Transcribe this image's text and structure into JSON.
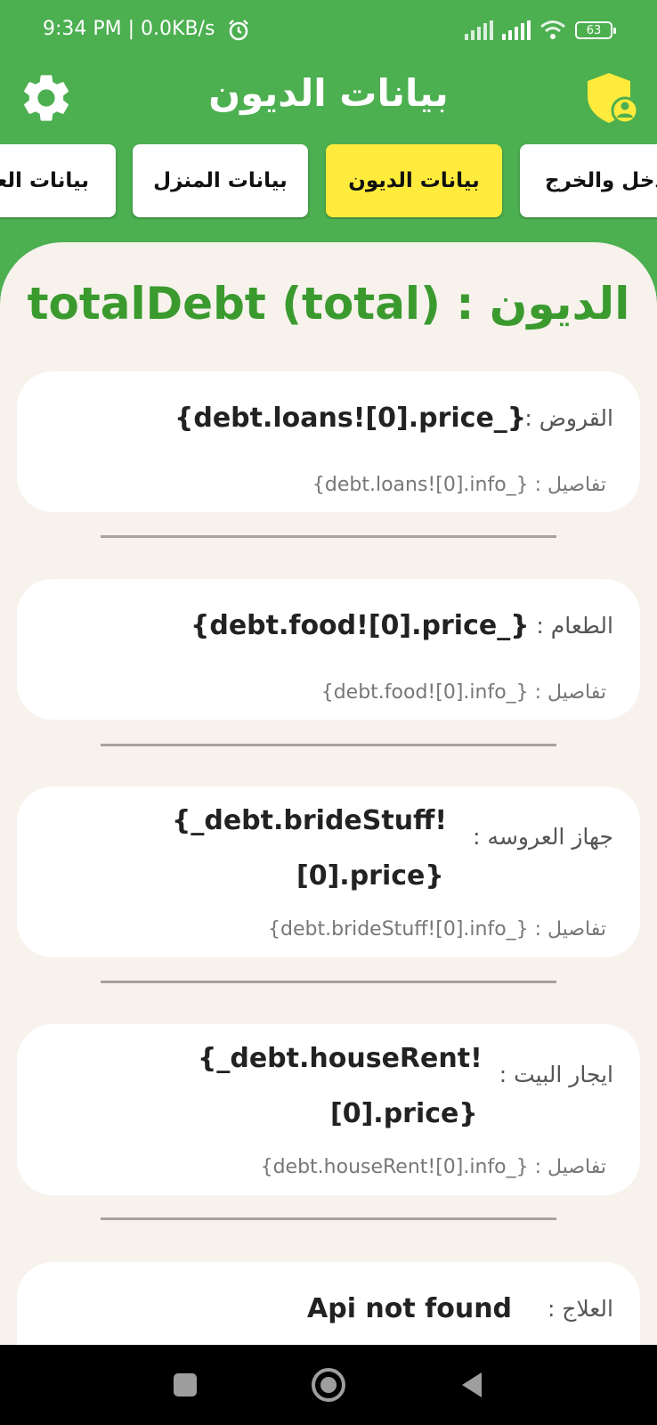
{
  "status_bar": {
    "time_speed": "9:34 PM | 0.0KB/s",
    "battery": "63"
  },
  "app_bar": {
    "title": "بيانات الديون"
  },
  "tabs": [
    {
      "label": "الدخل والخرج",
      "active": false
    },
    {
      "label": "بيانات الديون",
      "active": true
    },
    {
      "label": "بيانات المنزل",
      "active": false
    },
    {
      "label": "بيانات العـ",
      "active": false
    }
  ],
  "total": {
    "text": "الديون : totalDebt (total)"
  },
  "debts": [
    {
      "label": "القروض :",
      "value": "{debt.loans![0].price_}",
      "info": "تفاصيل : {_debt.loans![0].info}"
    },
    {
      "label": "الطعام :",
      "value": "{debt.food![0].price_}",
      "info": "تفاصيل : {_debt.food![0].info}"
    },
    {
      "label": "جهاز العروسه :",
      "value_line1": "{_debt.brideStuff!",
      "value_line2": "[0].price}",
      "info": "تفاصيل : {_debt.brideStuff![0].info}"
    },
    {
      "label": "ايجار البيت :",
      "value_line1": "{_debt.houseRent!",
      "value_line2": "[0].price}",
      "info": "تفاصيل : {_debt.houseRent![0].info}"
    },
    {
      "label": "العلاج :",
      "value": "Api not found"
    }
  ]
}
